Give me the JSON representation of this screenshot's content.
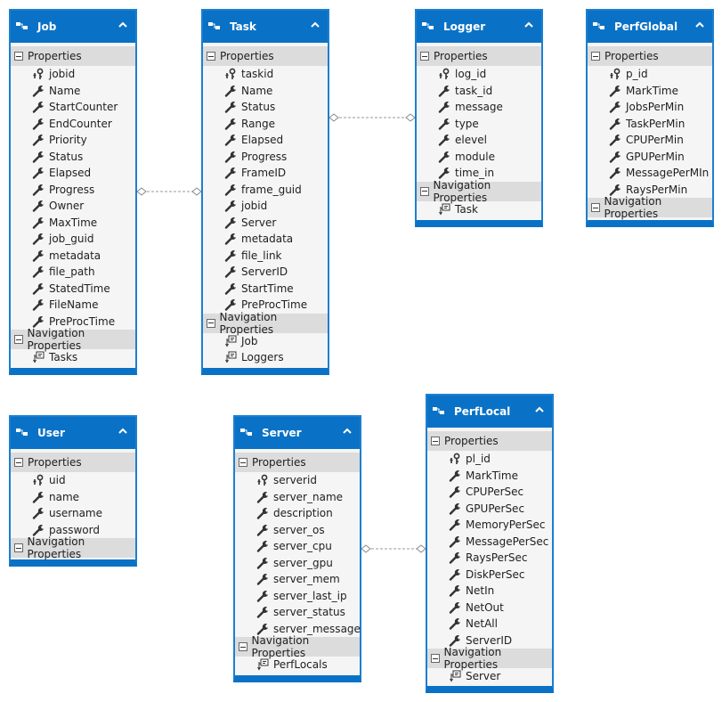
{
  "colors": {
    "title_bar": "#0a72c6",
    "section_header": "#dcdcdc",
    "body": "#f5f5f5"
  },
  "labels": {
    "properties": "Properties",
    "navigation": "Navigation Properties"
  },
  "entities": [
    {
      "id": "job",
      "name": "Job",
      "properties": [
        {
          "name": "jobid",
          "key": true
        },
        {
          "name": "Name"
        },
        {
          "name": "StartCounter"
        },
        {
          "name": "EndCounter"
        },
        {
          "name": "Priority"
        },
        {
          "name": "Status"
        },
        {
          "name": "Elapsed"
        },
        {
          "name": "Progress"
        },
        {
          "name": "Owner"
        },
        {
          "name": "MaxTime"
        },
        {
          "name": "job_guid"
        },
        {
          "name": "metadata"
        },
        {
          "name": "file_path"
        },
        {
          "name": "StatedTime"
        },
        {
          "name": "FileName"
        },
        {
          "name": "PreProcTime"
        }
      ],
      "navigation": [
        "Tasks"
      ]
    },
    {
      "id": "task",
      "name": "Task",
      "properties": [
        {
          "name": "taskid",
          "key": true
        },
        {
          "name": "Name"
        },
        {
          "name": "Status"
        },
        {
          "name": "Range"
        },
        {
          "name": "Elapsed"
        },
        {
          "name": "Progress"
        },
        {
          "name": "FrameID"
        },
        {
          "name": "frame_guid"
        },
        {
          "name": "jobid"
        },
        {
          "name": "Server"
        },
        {
          "name": "metadata"
        },
        {
          "name": "file_link"
        },
        {
          "name": "ServerID"
        },
        {
          "name": "StartTime"
        },
        {
          "name": "PreProcTime"
        }
      ],
      "navigation": [
        "Job",
        "Loggers"
      ]
    },
    {
      "id": "logger",
      "name": "Logger",
      "properties": [
        {
          "name": "log_id",
          "key": true
        },
        {
          "name": "task_id"
        },
        {
          "name": "message"
        },
        {
          "name": "type"
        },
        {
          "name": "elevel"
        },
        {
          "name": "module"
        },
        {
          "name": "time_in"
        }
      ],
      "navigation": [
        "Task"
      ]
    },
    {
      "id": "perfglobal",
      "name": "PerfGlobal",
      "properties": [
        {
          "name": "p_id",
          "key": true
        },
        {
          "name": "MarkTime"
        },
        {
          "name": "JobsPerMin"
        },
        {
          "name": "TaskPerMin"
        },
        {
          "name": "CPUPerMin"
        },
        {
          "name": "GPUPerMin"
        },
        {
          "name": "MessagePerMIn"
        },
        {
          "name": "RaysPerMin"
        }
      ],
      "navigation": []
    },
    {
      "id": "user",
      "name": "User",
      "properties": [
        {
          "name": "uid",
          "key": true
        },
        {
          "name": "name"
        },
        {
          "name": "username"
        },
        {
          "name": "password"
        }
      ],
      "navigation": []
    },
    {
      "id": "server",
      "name": "Server",
      "properties": [
        {
          "name": "serverid",
          "key": true
        },
        {
          "name": "server_name"
        },
        {
          "name": "description"
        },
        {
          "name": "server_os"
        },
        {
          "name": "server_cpu"
        },
        {
          "name": "server_gpu"
        },
        {
          "name": "server_mem"
        },
        {
          "name": "server_last_ip"
        },
        {
          "name": "server_status"
        },
        {
          "name": "server_message"
        }
      ],
      "navigation": [
        "PerfLocals"
      ]
    },
    {
      "id": "perflocal",
      "name": "PerfLocal",
      "properties": [
        {
          "name": "pl_id",
          "key": true
        },
        {
          "name": "MarkTime"
        },
        {
          "name": "CPUPerSec"
        },
        {
          "name": "GPUPerSec"
        },
        {
          "name": "MemoryPerSec"
        },
        {
          "name": "MessagePerSec"
        },
        {
          "name": "RaysPerSec"
        },
        {
          "name": "DiskPerSec"
        },
        {
          "name": "NetIn"
        },
        {
          "name": "NetOut"
        },
        {
          "name": "NetAll"
        },
        {
          "name": "ServerID"
        }
      ],
      "navigation": [
        "Server"
      ]
    }
  ],
  "associations": [
    {
      "from": "job",
      "to": "task"
    },
    {
      "from": "task",
      "to": "logger"
    },
    {
      "from": "server",
      "to": "perflocal"
    }
  ]
}
